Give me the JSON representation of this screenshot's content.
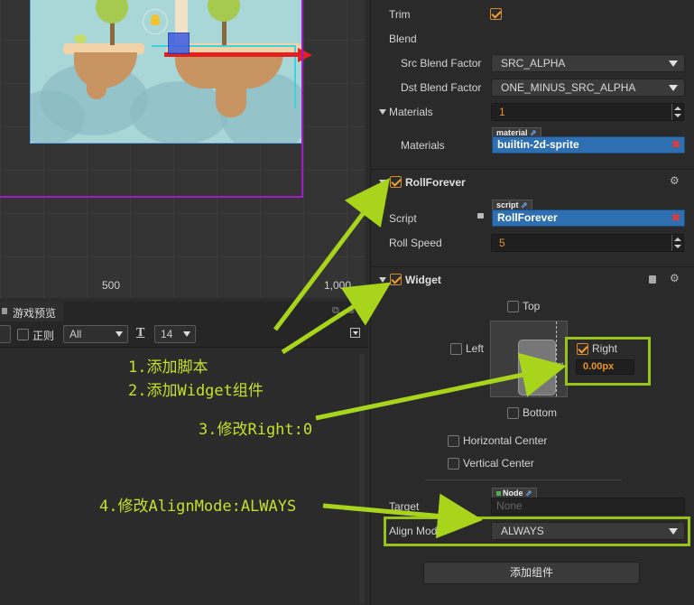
{
  "scene": {
    "ruler_labels": [
      "500",
      "1,000"
    ]
  },
  "preview": {
    "tab_label": "游戏预览",
    "regex_label": "正则",
    "filter_value": "All",
    "font_size_value": "14"
  },
  "inspector": {
    "trim_label": "Trim",
    "blend_label": "Blend",
    "src_blend_label": "Src Blend Factor",
    "src_blend_value": "SRC_ALPHA",
    "dst_blend_label": "Dst Blend Factor",
    "dst_blend_value": "ONE_MINUS_SRC_ALPHA",
    "materials_label": "Materials",
    "materials_count": "1",
    "materials_item_label": "Materials",
    "material_tag": "material",
    "material_value": "builtin-2d-sprite",
    "roll_forever": {
      "title": "RollForever",
      "script_label": "Script",
      "script_tag": "script",
      "script_value": "RollForever",
      "roll_speed_label": "Roll Speed",
      "roll_speed_value": "5"
    },
    "widget": {
      "title": "Widget",
      "top_label": "Top",
      "left_label": "Left",
      "right_label": "Right",
      "right_value": "0.00px",
      "bottom_label": "Bottom",
      "horizontal_center_label": "Horizontal Center",
      "vertical_center_label": "Vertical Center",
      "target_label": "Target",
      "target_tag": "Node",
      "target_value": "None",
      "align_mode_label": "Align Mode",
      "align_mode_value": "ALWAYS"
    },
    "add_component_label": "添加组件"
  },
  "annotations": {
    "step1": "1.添加脚本",
    "step2": "2.添加Widget组件",
    "step3": "3.修改Right:0",
    "step4": "4.修改AlignMode:ALWAYS"
  },
  "colors": {
    "annotation": "#c4e02a",
    "highlight_border": "#98c41a",
    "checkbox_accent": "#f0a030",
    "asset_blue": "#2d6fb0",
    "number_orange": "#e8942d"
  }
}
